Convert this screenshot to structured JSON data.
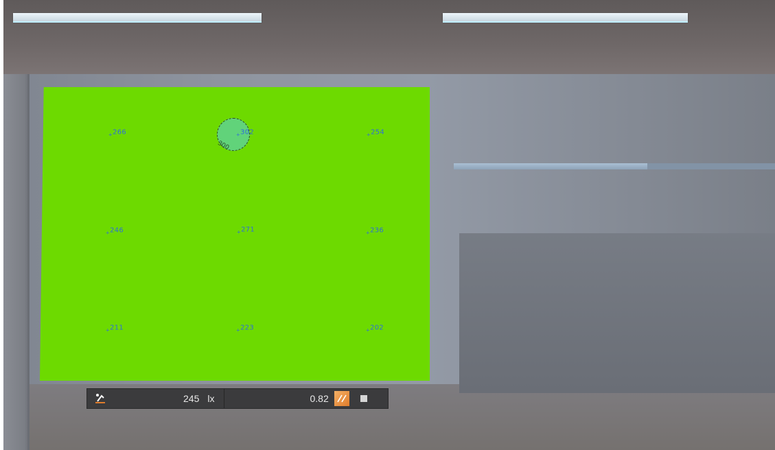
{
  "calculation_points": [
    {
      "value": "266"
    },
    {
      "value": "302"
    },
    {
      "value": "254"
    },
    {
      "value": "246"
    },
    {
      "value": "271"
    },
    {
      "value": "236"
    },
    {
      "value": "211"
    },
    {
      "value": "223"
    },
    {
      "value": "202"
    }
  ],
  "isoline": {
    "label": "300"
  },
  "result_bar": {
    "average_value": "245",
    "unit": "lx",
    "uniformity": "0.82",
    "tool_icon": "calculation-tool-icon",
    "uniformity_icon": "uniformity-icon",
    "stop_icon": "stop-icon"
  },
  "colors": {
    "surface": "#6dda00",
    "point_text": "#2f6fd8",
    "toolbar_bg": "#3b3b3d",
    "accent_orange": "#e07c2b"
  }
}
